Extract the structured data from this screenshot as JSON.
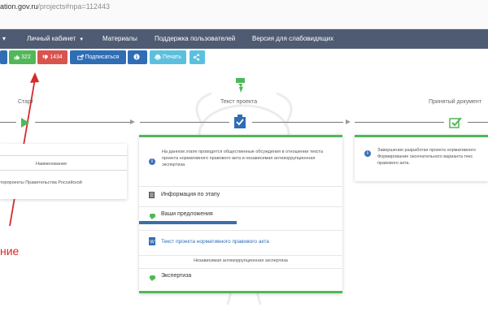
{
  "browser": {
    "url_host": "ation.gov.ru",
    "url_path": "/projects#npa=112443"
  },
  "navbar": {
    "caret_item": "▾",
    "cabinet": "Личный кабинет",
    "materials": "Материалы",
    "support": "Поддержка пользователей",
    "accessible": "Версия для слабовидящих"
  },
  "actions": {
    "likes": "322",
    "dislikes": "1434",
    "subscribe": "Подписаться",
    "print": "Печать"
  },
  "stages": {
    "start": "Старт",
    "text": "Текст проекта",
    "accepted": "Принятый документ"
  },
  "left_card": {
    "header": "Наименование",
    "body": "торпроекты Правительства Российской"
  },
  "center_card": {
    "info": "На данном этапе проводятся общественные обсуждения в отношении текста проекта нормативного правового акта и независимая антикоррупционная экспертиза",
    "stage_info": "Информация по этапу",
    "proposals": "Ваши предложения",
    "doc_link": "Текст проекта нормативного правового акта",
    "section": "Независимая антикоррупционная экспертиза",
    "expertise": "Экспертиза"
  },
  "right_card": {
    "info": "Завершение разработки проекта нормативного Формирование окончательного варианта текс правового акта."
  },
  "annotation": {
    "label": "ние"
  },
  "colors": {
    "navbar": "#4e5b72",
    "primary_blue": "#2f6db5",
    "green": "#52b758",
    "red": "#d9534f",
    "light_blue": "#5bc0de",
    "annotation_red": "#d42a2a"
  }
}
